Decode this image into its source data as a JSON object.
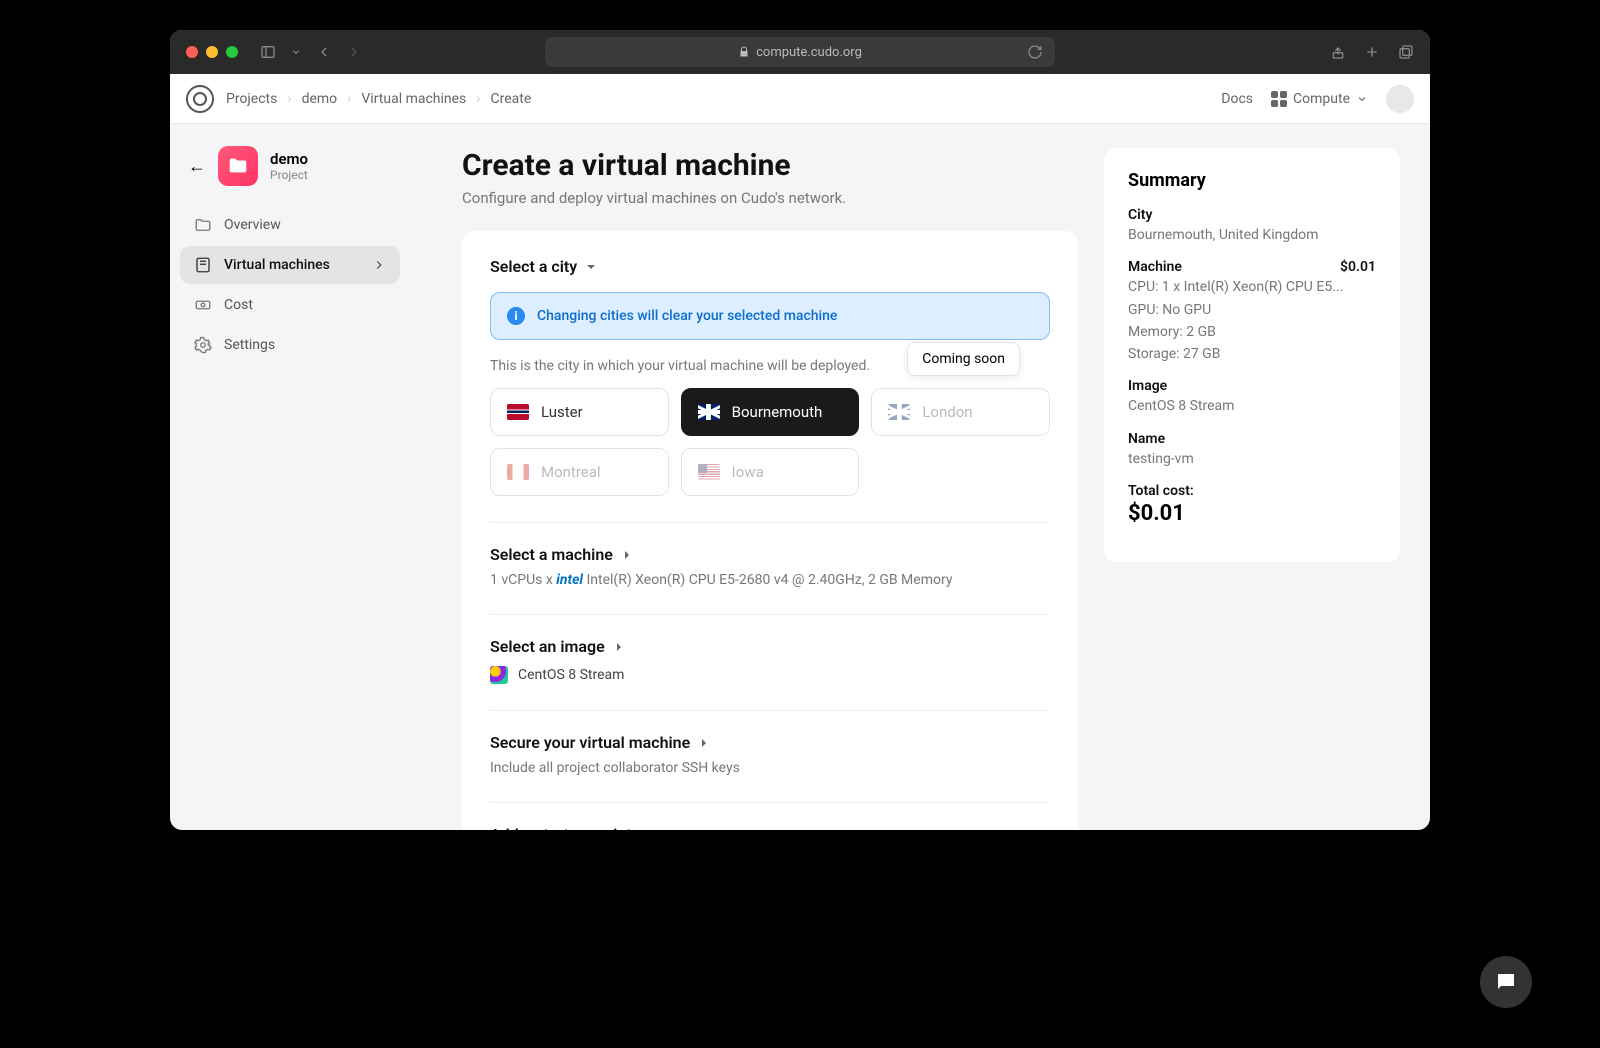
{
  "browser": {
    "url": "compute.cudo.org"
  },
  "breadcrumbs": {
    "a": "Projects",
    "b": "demo",
    "c": "Virtual machines",
    "d": "Create"
  },
  "header": {
    "docs": "Docs",
    "compute": "Compute"
  },
  "project": {
    "name": "demo",
    "sub": "Project"
  },
  "nav": {
    "overview": "Overview",
    "vms": "Virtual machines",
    "cost": "Cost",
    "settings": "Settings"
  },
  "page": {
    "title": "Create a virtual machine",
    "subtitle": "Configure and deploy virtual machines on Cudo's network."
  },
  "city": {
    "heading": "Select a city",
    "alert": "Changing cities will clear your selected machine",
    "hint": "This is the city in which your virtual machine will be deployed.",
    "tooltip": "Coming soon",
    "options": {
      "luster": "Luster",
      "bournemouth": "Bournemouth",
      "london": "London",
      "montreal": "Montreal",
      "iowa": "Iowa"
    }
  },
  "machine": {
    "heading": "Select a machine",
    "line_pre": "1 vCPUs x ",
    "brand": "intel",
    "line_post": " Intel(R) Xeon(R) CPU E5-2680 v4 @ 2.40GHz, 2 GB Memory"
  },
  "image": {
    "heading": "Select an image",
    "value": "CentOS 8 Stream"
  },
  "secure": {
    "heading": "Secure your virtual machine",
    "line": "Include all project collaborator SSH keys"
  },
  "startup": {
    "heading": "Add a startup script"
  },
  "summary": {
    "title": "Summary",
    "city_label": "City",
    "city_val": "Bournemouth, United Kingdom",
    "machine_label": "Machine",
    "machine_price": "$0.01",
    "m1": "CPU: 1 x Intel(R) Xeon(R) CPU E5...",
    "m2": "GPU: No GPU",
    "m3": "Memory: 2 GB",
    "m4": "Storage: 27 GB",
    "image_label": "Image",
    "image_val": "CentOS 8 Stream",
    "name_label": "Name",
    "name_val": "testing-vm",
    "total_label": "Total cost:",
    "total_val": "$0.01"
  }
}
